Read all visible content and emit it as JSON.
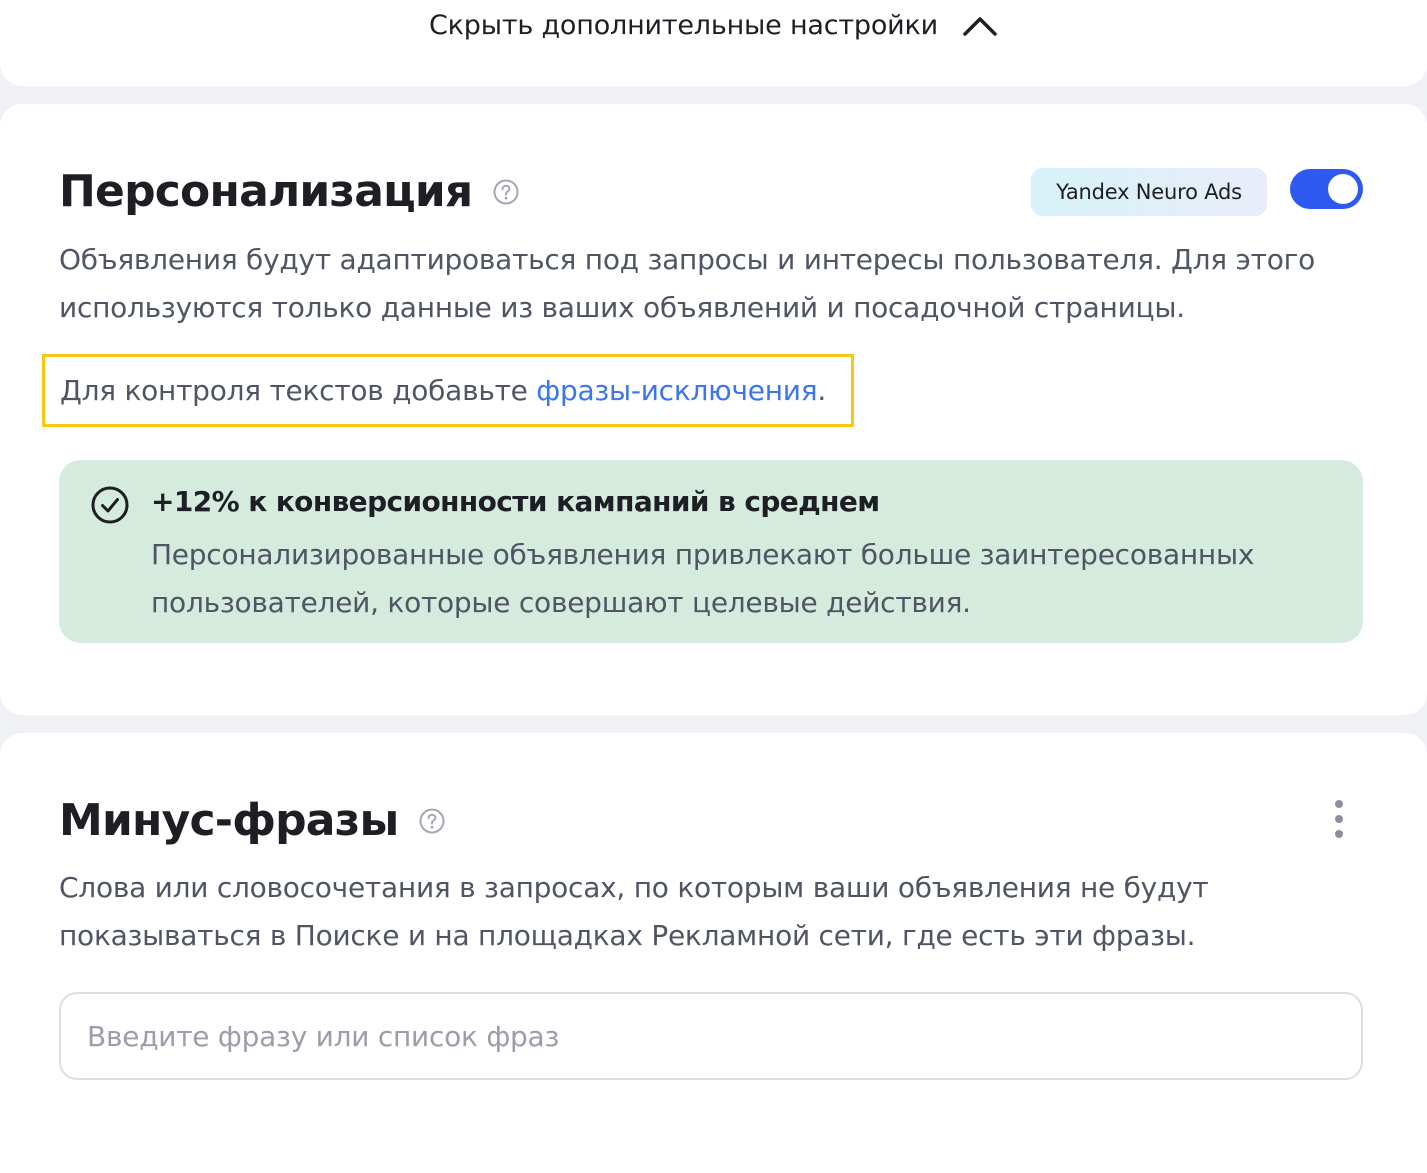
{
  "top_bar": {
    "hide_settings_label": "Скрыть дополнительные настройки",
    "chevron_icon": "chevron-up-icon"
  },
  "personalization": {
    "title": "Персонализация",
    "help_icon": "help-circle-icon",
    "badge": "Yandex Neuro Ads",
    "toggle_on": true,
    "description_line1": "Объявления будут адаптироваться под запросы и интересы пользователя. Для этого",
    "description_line2": "используются только данные из ваших объявлений и посадочной страницы.",
    "control_text_before": "Для контроля текстов добавьте ",
    "control_link": "фразы-исключения",
    "control_text_after": ".",
    "benefit": {
      "icon": "check-circle-icon",
      "title": "+12% к конверсионности кампаний в среднем",
      "text_line1": "Персонализированные объявления привлекают больше заинтересованных",
      "text_line2": "пользователей, которые совершают целевые действия."
    }
  },
  "minus_phrases": {
    "title": "Минус-фразы",
    "help_icon": "help-circle-icon",
    "more_icon": "more-vertical-icon",
    "description_line1": "Слова или словосочетания в запросах, по которым ваши объявления не будут",
    "description_line2": "показываться в Поиске и на площадках Рекламной сети, где есть эти фразы.",
    "input_value": "",
    "input_placeholder": "Введите фразу или список фраз"
  },
  "colors": {
    "accent": "#2d59f0",
    "link": "#3b75ef",
    "highlight_border": "#f6c90e",
    "benefit_bg": "#d4ebde",
    "page_bg": "#f0f1f5"
  }
}
